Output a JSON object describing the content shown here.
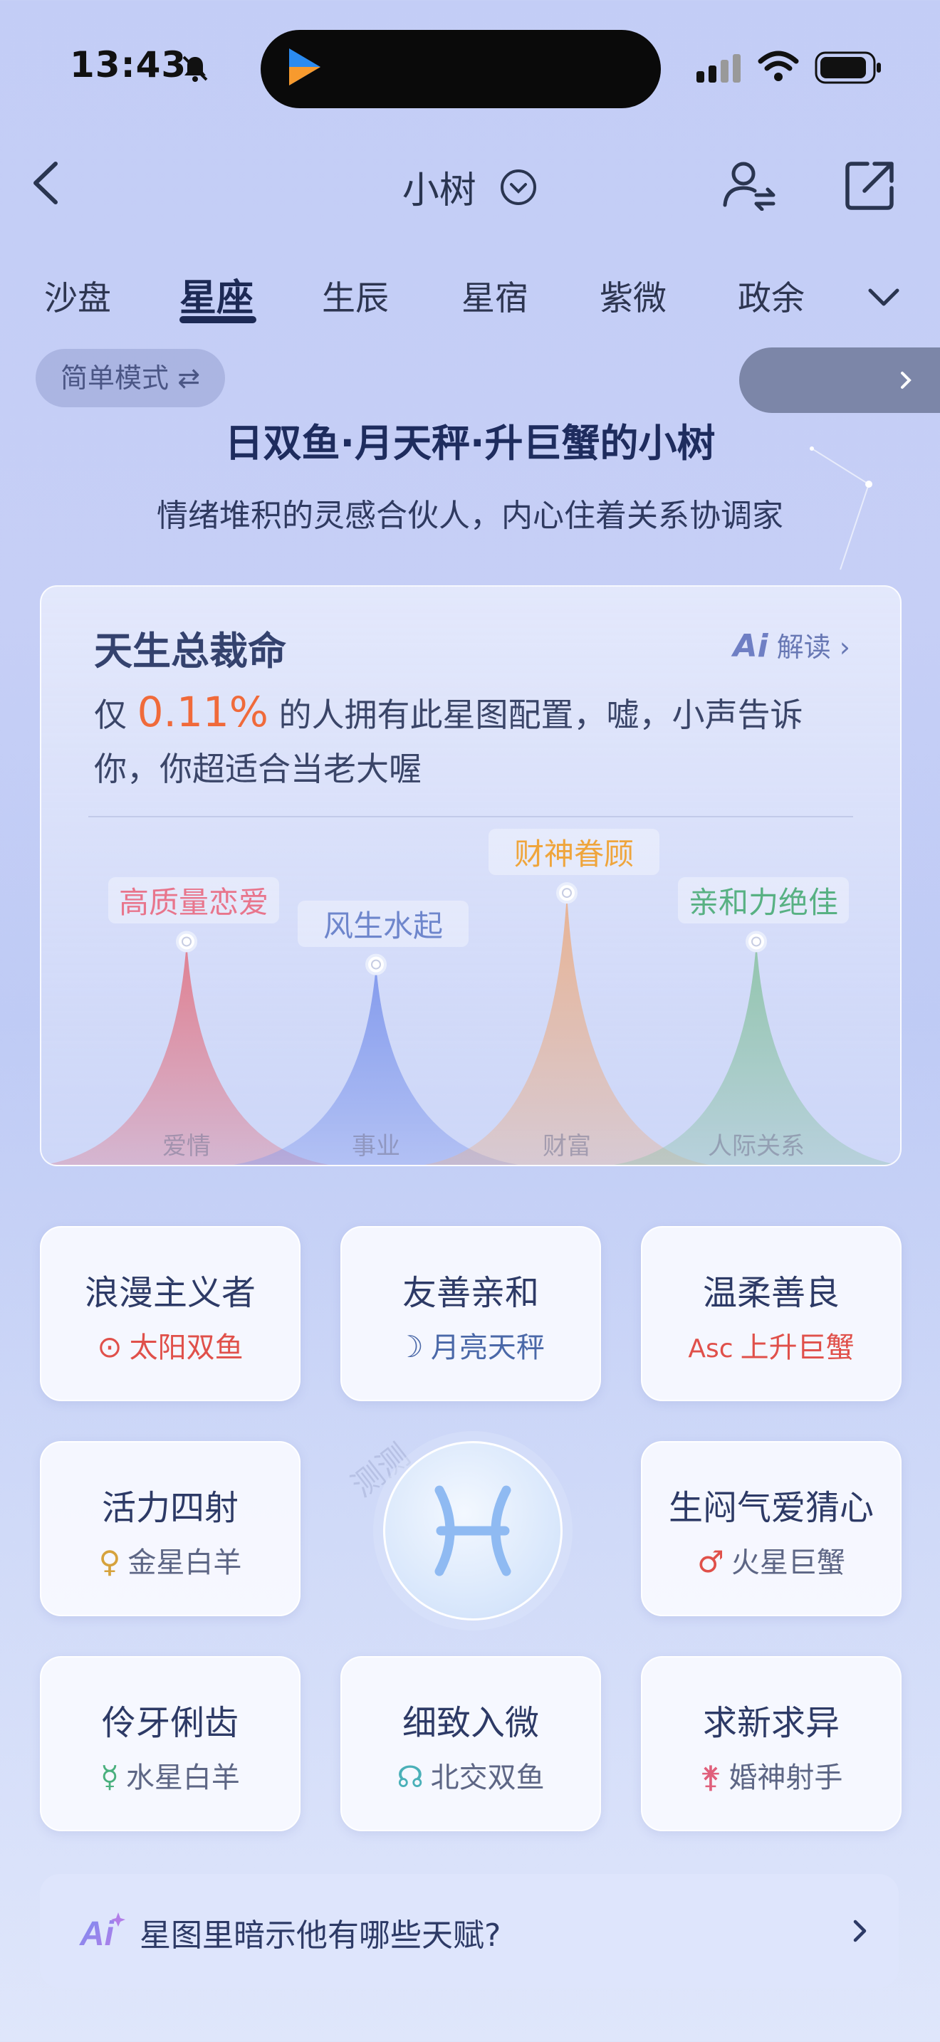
{
  "status_bar": {
    "time": "13:43"
  },
  "nav": {
    "title": "小树"
  },
  "tabs": [
    {
      "label": "沙盘",
      "active": false
    },
    {
      "label": "星座",
      "active": true
    },
    {
      "label": "生辰",
      "active": false
    },
    {
      "label": "星宿",
      "active": false
    },
    {
      "label": "紫微",
      "active": false
    },
    {
      "label": "政余",
      "active": false
    }
  ],
  "mode": {
    "label": "简单模式 ⇄"
  },
  "header": {
    "headline": "日双鱼·月天秤·升巨蟹的小树",
    "subline": "情绪堆积的灵感合伙人，内心住着关系协调家"
  },
  "card": {
    "title": "天生总裁命",
    "ai_label": "解读",
    "desc_prefix": "仅 ",
    "percent": "0.11%",
    "desc_suffix": " 的人拥有此星图配置，嘘，小声告诉你，你超适合当老大喔",
    "peaks": [
      {
        "tag": "高质量恋爱",
        "axis": "爱情",
        "level": 0.78,
        "color": "#e07a8a",
        "tag_color": "#e8758c"
      },
      {
        "tag": "风生水起",
        "axis": "事业",
        "level": 0.7,
        "color": "#7f97ec",
        "tag_color": "#6e86cc"
      },
      {
        "tag": "财神眷顾",
        "axis": "财富",
        "level": 0.95,
        "color": "#e8b08e",
        "tag_color": "#efa53c"
      },
      {
        "tag": "亲和力绝佳",
        "axis": "人际关系",
        "level": 0.78,
        "color": "#8ec3a8",
        "tag_color": "#58b183"
      }
    ]
  },
  "traits": [
    {
      "title": "浪漫主义者",
      "sym": "⊙",
      "sub": "太阳双鱼",
      "color": "#e0504a"
    },
    {
      "title": "友善亲和",
      "sym": "☽",
      "sub": "月亮天秤",
      "color": "#4a68a8"
    },
    {
      "title": "温柔善良",
      "sym": "Asc",
      "sub": "上升巨蟹",
      "color": "#e0504a"
    },
    {
      "title": "活力四射",
      "sym": "♀",
      "sub": "金星白羊",
      "color": "#d6a23c"
    },
    {
      "title": "生闷气爱猜心",
      "sym": "♂",
      "sub": "火星巨蟹",
      "color": "#e0504a"
    },
    {
      "title": "伶牙俐齿",
      "sym": "☿",
      "sub": "水星白羊",
      "color": "#4ab07e"
    },
    {
      "title": "细致入微",
      "sym": "☊",
      "sub": "北交双鱼",
      "color": "#4ab0b8"
    },
    {
      "title": "求新求异",
      "sym": "⚵",
      "sub": "婚神射手",
      "color": "#e0607c"
    }
  ],
  "center": {
    "watermark": "测测",
    "glyph": "pisces-icon"
  },
  "bottom": {
    "text": "星图里暗示他有哪些天赋?"
  }
}
